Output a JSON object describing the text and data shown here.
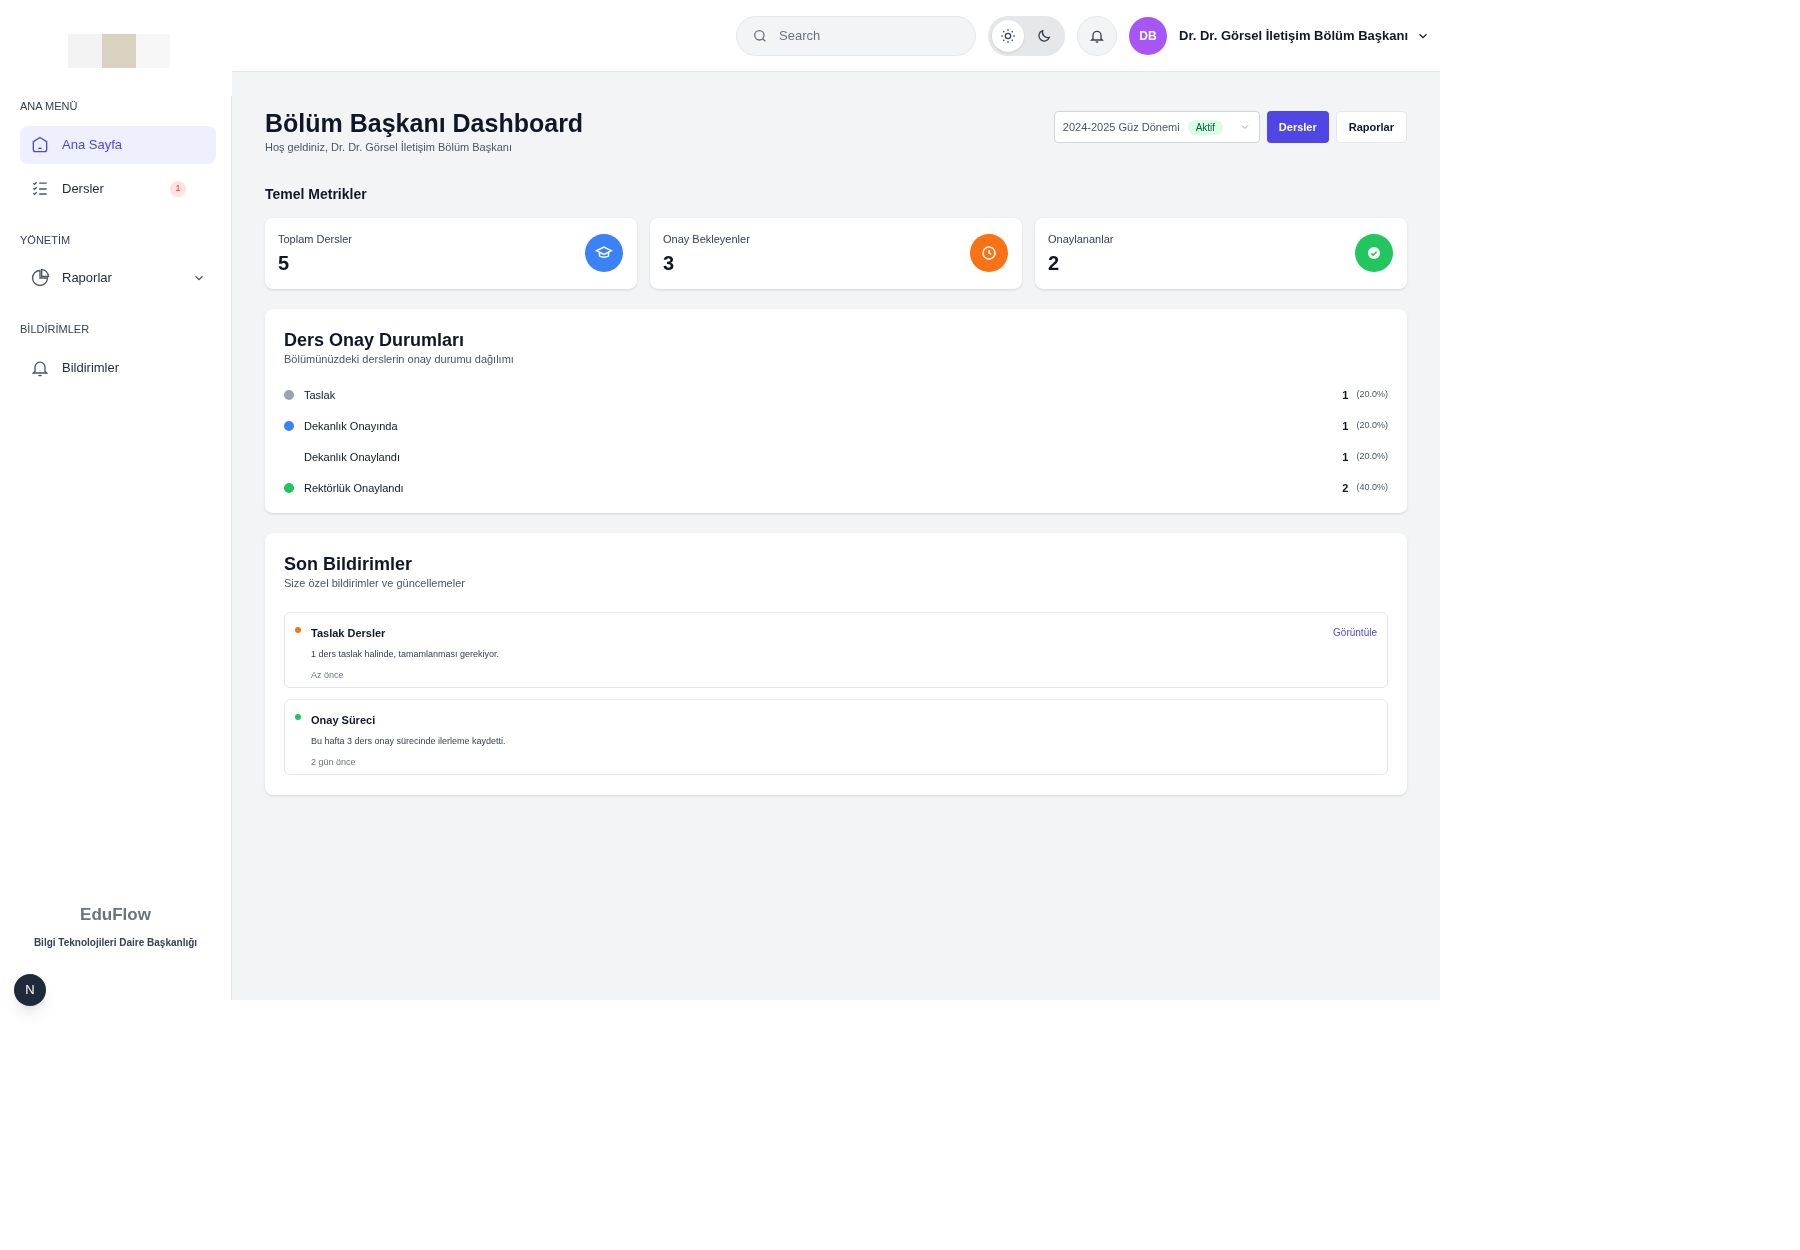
{
  "sidebar": {
    "sections": [
      {
        "title": "ANA MENÜ",
        "items": [
          {
            "label": "Ana Sayfa",
            "selected": true
          },
          {
            "label": "Dersler",
            "selected": false,
            "badge": "1"
          }
        ]
      },
      {
        "title": "YÖNETİM",
        "items": [
          {
            "label": "Raporlar",
            "selected": false,
            "expanded": false
          }
        ]
      },
      {
        "title": "BİLDİRİMLER",
        "items": [
          {
            "label": "Bildirimler",
            "selected": false
          }
        ]
      }
    ],
    "footer": {
      "brand": "EduFlow",
      "subtitle": "Bilgi Teknolojileri Daire Başkanlığı"
    },
    "floating_button": "N"
  },
  "header": {
    "search": {
      "placeholder": "Search"
    },
    "dark_mode": false,
    "avatar": "DB",
    "user": "Dr. Dr. Görsel İletişim Bölüm Başkanı"
  },
  "page": {
    "title": "Bölüm Başkanı Dashboard",
    "subtitle": "Hoş geldiniz, Dr. Dr. Görsel İletişim Bölüm Başkanı",
    "term": {
      "value": "2024-2025 Güz Dönemi",
      "badge": "Aktif"
    },
    "buttons": [
      {
        "label": "Dersler",
        "kind": "primary"
      },
      {
        "label": "Raporlar",
        "kind": "secondary"
      }
    ]
  },
  "metrics": {
    "title": "Temel Metrikler",
    "cards": [
      {
        "label": "Toplam Dersler",
        "value": "5",
        "color": "#3b82f6"
      },
      {
        "label": "Onay Bekleyenler",
        "value": "3",
        "color": "#f97316"
      },
      {
        "label": "Onaylananlar",
        "value": "2",
        "color": "#22c55e"
      }
    ]
  },
  "status": {
    "title": "Ders Onay Durumları",
    "subtitle": "Bölümünüzdeki derslerin onay durumu dağılımı",
    "rows": [
      {
        "label": "Taslak",
        "count": "1",
        "percent": "(20.0%)",
        "color": "#9ca3af"
      },
      {
        "label": "Dekanlık Onayında",
        "count": "1",
        "percent": "(20.0%)",
        "color": "#3b82f6"
      },
      {
        "label": "Dekanlık Onaylandı",
        "count": "1",
        "percent": "(20.0%)"
      },
      {
        "label": "Rektörlük Onaylandı",
        "count": "2",
        "percent": "(40.0%)",
        "color": "#22c55e"
      }
    ]
  },
  "notifications": {
    "title": "Son Bildirimler",
    "subtitle": "Size özel bildirimler ve güncellemeler",
    "items": [
      {
        "title": "Taslak Dersler",
        "text": "1 ders taslak halinde, tamamlanması gerekiyor.",
        "time": "Az önce",
        "color": "#f97316",
        "link": "Görüntüle"
      },
      {
        "title": "Onay Süreci",
        "text": "Bu hafta 3 ders onay sürecinde ilerleme kaydetti.",
        "time": "2 gün önce",
        "color": "#22c55e"
      }
    ]
  }
}
